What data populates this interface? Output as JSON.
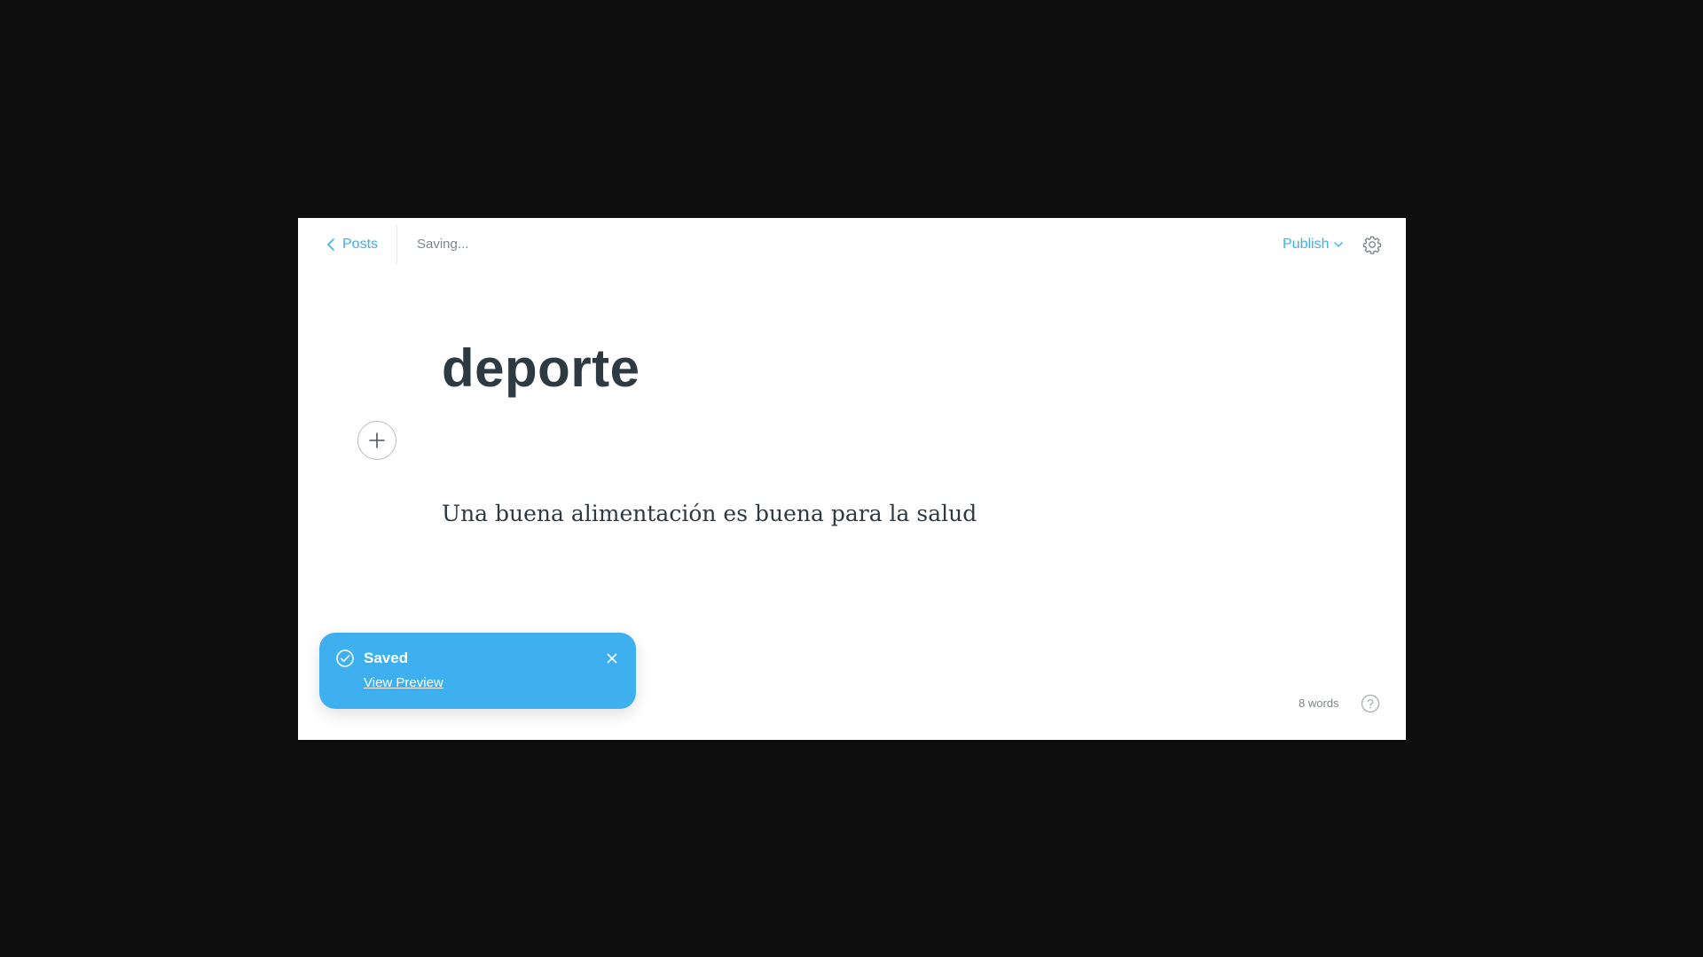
{
  "topbar": {
    "back_label": "Posts",
    "back_icon": "chevron-left-icon",
    "status": "Saving...",
    "publish_label": "Publish",
    "publish_icon": "chevron-down-icon",
    "settings_icon": "gear-icon"
  },
  "editor": {
    "title": "deporte",
    "body": "Una buena alimentación es buena para la salud",
    "add_card_icon": "plus-icon"
  },
  "toast": {
    "title": "Saved",
    "link_label": "View Preview",
    "icon": "check-circle-icon",
    "close_icon": "close-icon",
    "background": "#3eb0ef"
  },
  "footer": {
    "word_count": "8 words",
    "help_icon": "question-circle-icon"
  },
  "colors": {
    "accent": "#3eb0ef",
    "text": "#2e3a41",
    "muted": "#7d878a",
    "backdrop": "#0e0e0f"
  }
}
